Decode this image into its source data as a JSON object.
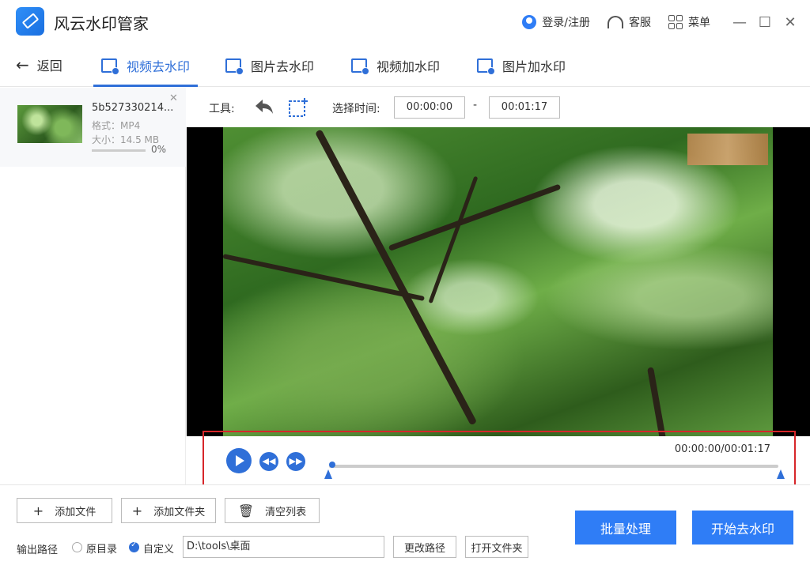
{
  "app": {
    "title": "风云水印管家"
  },
  "titlebar": {
    "login_label": "登录/注册",
    "service_label": "客服",
    "menu_label": "菜单"
  },
  "nav": {
    "back_label": "返回",
    "tabs": [
      {
        "label": "视频去水印",
        "icon": "video-icon",
        "active": true
      },
      {
        "label": "图片去水印",
        "icon": "image-icon",
        "active": false
      },
      {
        "label": "视频加水印",
        "icon": "video-icon",
        "active": false
      },
      {
        "label": "图片加水印",
        "icon": "image-icon",
        "active": false
      }
    ]
  },
  "file_list": [
    {
      "name": "5b527330214...",
      "format": "格式：MP4",
      "size": "大小：14.5 MB",
      "progress_text": "0%",
      "progress": 0
    }
  ],
  "toolbar": {
    "tool_label": "工具:",
    "time_label": "选择时间:",
    "start_time": "00:00:00",
    "dash": "-",
    "end_time": "00:01:17"
  },
  "player": {
    "time_readout": "00:00:00/00:01:17",
    "position": 0
  },
  "bottom": {
    "add_file_label": "添加文件",
    "add_folder_label": "添加文件夹",
    "clear_list_label": "清空列表",
    "output_path_label": "输出路径",
    "radio_original_label": "原目录",
    "radio_custom_label": "自定义",
    "path_value": "D:\\tools\\桌面",
    "change_path_label": "更改路径",
    "open_folder_label": "打开文件夹",
    "batch_label": "批量处理",
    "start_label": "开始去水印"
  },
  "colors": {
    "accent": "#2f6fd8",
    "primary_button": "#2f7df6",
    "highlight_frame": "#d7262a"
  }
}
